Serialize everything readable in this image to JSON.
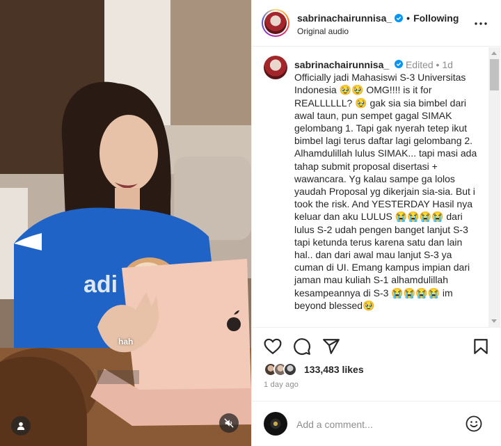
{
  "media": {
    "caption_word": "hah",
    "icons": {
      "user_tag": "person-icon",
      "mute": "speaker-muted-icon"
    }
  },
  "header": {
    "username": "sabrinachairunnisa_",
    "follow_status": "Following",
    "audio": "Original audio",
    "icons": {
      "verified": "verified-badge-icon",
      "more": "ellipsis-icon"
    }
  },
  "caption": {
    "username": "sabrinachairunnisa_",
    "edited": "Edited",
    "time": "1d",
    "text": "Officially jadi Mahasiswi S-3 Universitas Indonesia 🥹🥹 OMG!!!! is it for REALLLLLL? 🥹 gak sia sia bimbel dari awal taun, pun sempet gagal SIMAK gelombang 1. Tapi gak nyerah tetep ikut bimbel lagi terus daftar lagi gelombang 2. Alhamdulillah lulus SIMAK... tapi masi ada tahap submit proposal disertasi + wawancara. Yg kalau sampe ga lolos yaudah Proposal yg dikerjain sia-sia. But i took the risk. And YESTERDAY Hasil nya keluar dan aku LULUS 😭😭😭😭 dari lulus S-2 udah pengen banget lanjut S-3 tapi ketunda terus karena satu dan lain hal.. dan dari awal mau lanjut S-3 ya cuman di UI. Emang kampus impian dari jaman mau kuliah S-1 alhamdulillah kesampeannya di S-3 😭😭😭😭 im beyond blessed🥹"
  },
  "actions": {
    "icons": {
      "like": "heart-icon",
      "comment": "speech-bubble-icon",
      "share": "paper-plane-icon",
      "save": "bookmark-icon"
    },
    "likes": "133,483 likes",
    "time_ago": "1 day ago"
  },
  "add_comment": {
    "placeholder": "Add a comment...",
    "icons": {
      "emoji": "smiley-icon"
    }
  },
  "colors": {
    "text": "#262626",
    "muted": "#8e8e8e",
    "verified": "#0095f6",
    "border": "#efefef"
  }
}
